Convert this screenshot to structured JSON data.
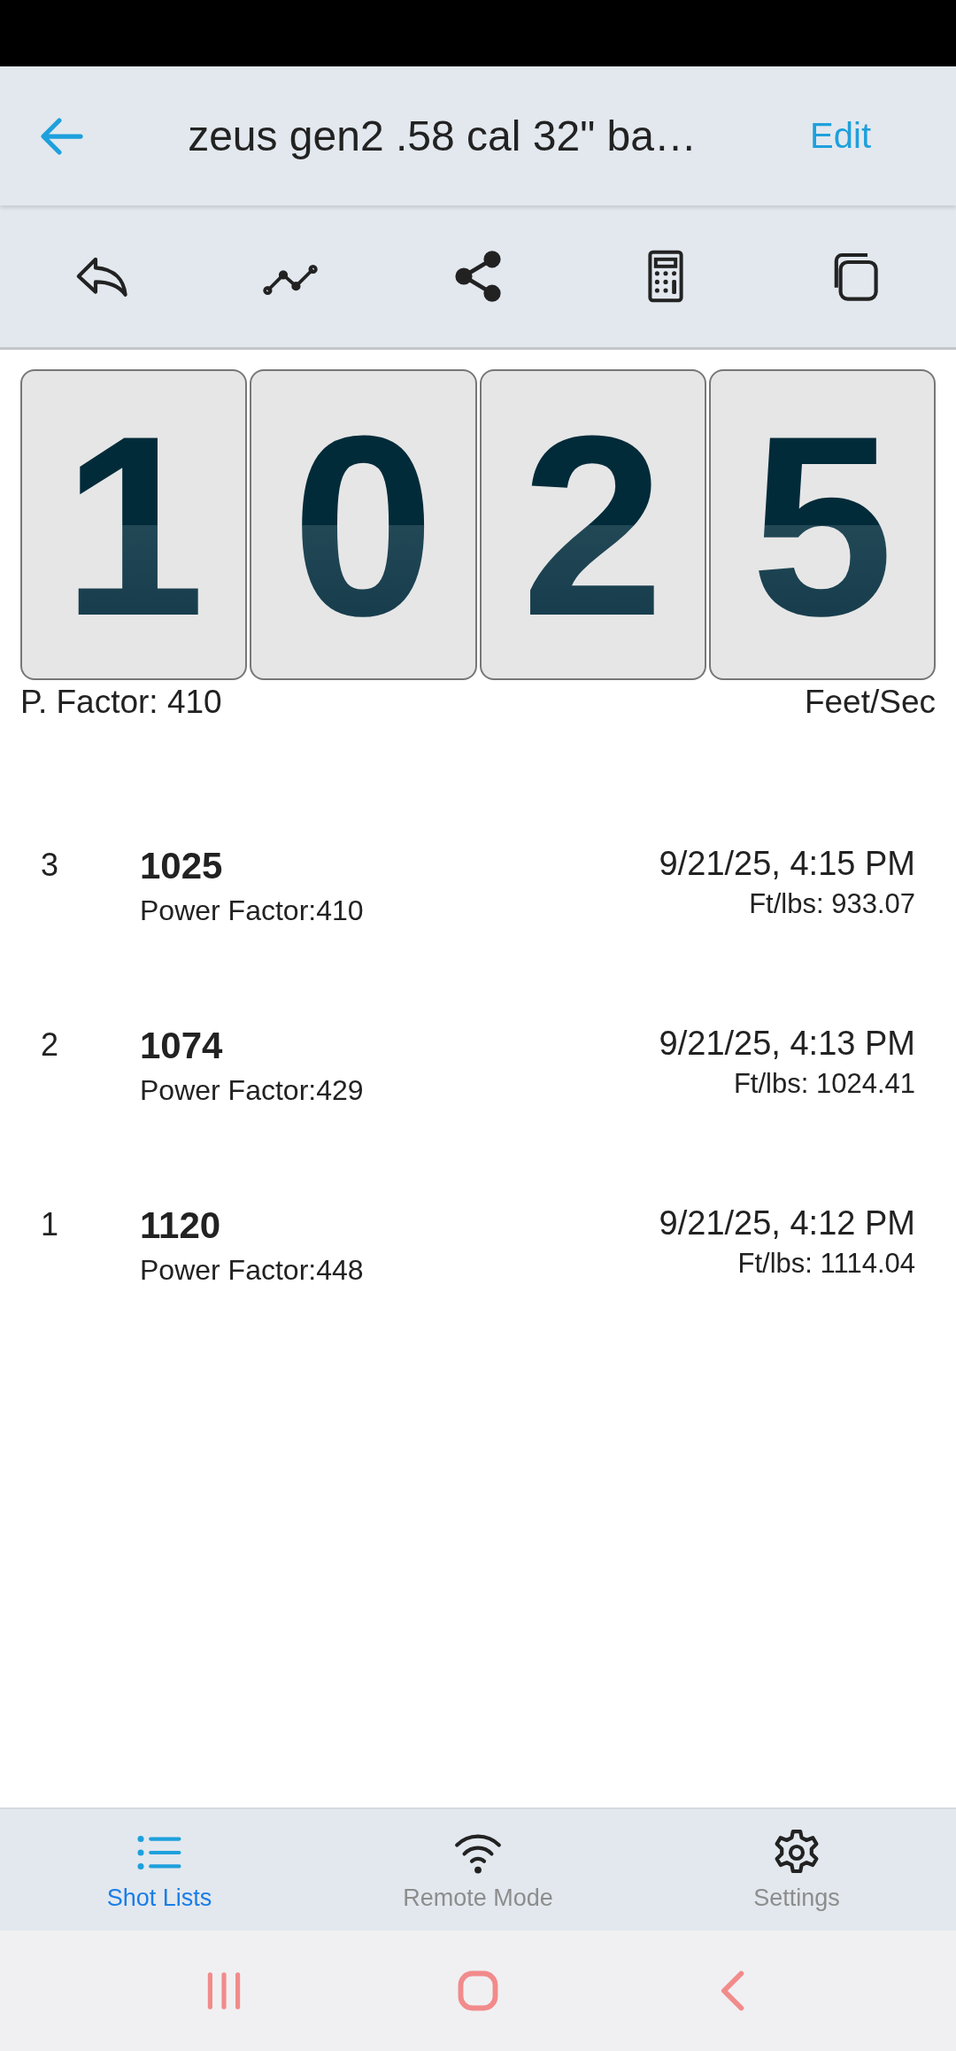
{
  "header": {
    "title": "zeus gen2 .58 cal 32\" ba…",
    "action": "Edit"
  },
  "display": {
    "digits": [
      "1",
      "0",
      "2",
      "5"
    ],
    "factor": "P. Factor: 410",
    "unit": "Feet/Sec"
  },
  "shots": [
    {
      "number": "3",
      "velocity": "1025",
      "power_factor": "Power Factor:410",
      "time": "9/21/25, 4:15 PM",
      "energy": "Ft/lbs: 933.07"
    },
    {
      "number": "2",
      "velocity": "1074",
      "power_factor": "Power Factor:429",
      "time": "9/21/25, 4:13 PM",
      "energy": "Ft/lbs: 1024.41"
    },
    {
      "number": "1",
      "velocity": "1120",
      "power_factor": "Power Factor:448",
      "time": "9/21/25, 4:12 PM",
      "energy": "Ft/lbs: 1114.04"
    }
  ],
  "tabs": [
    {
      "kind": "list",
      "label": "Shot Lists",
      "selected": true
    },
    {
      "kind": "wifi",
      "label": "Remote Mode",
      "selected": false
    },
    {
      "kind": "gear",
      "label": "Settings",
      "selected": false
    }
  ]
}
